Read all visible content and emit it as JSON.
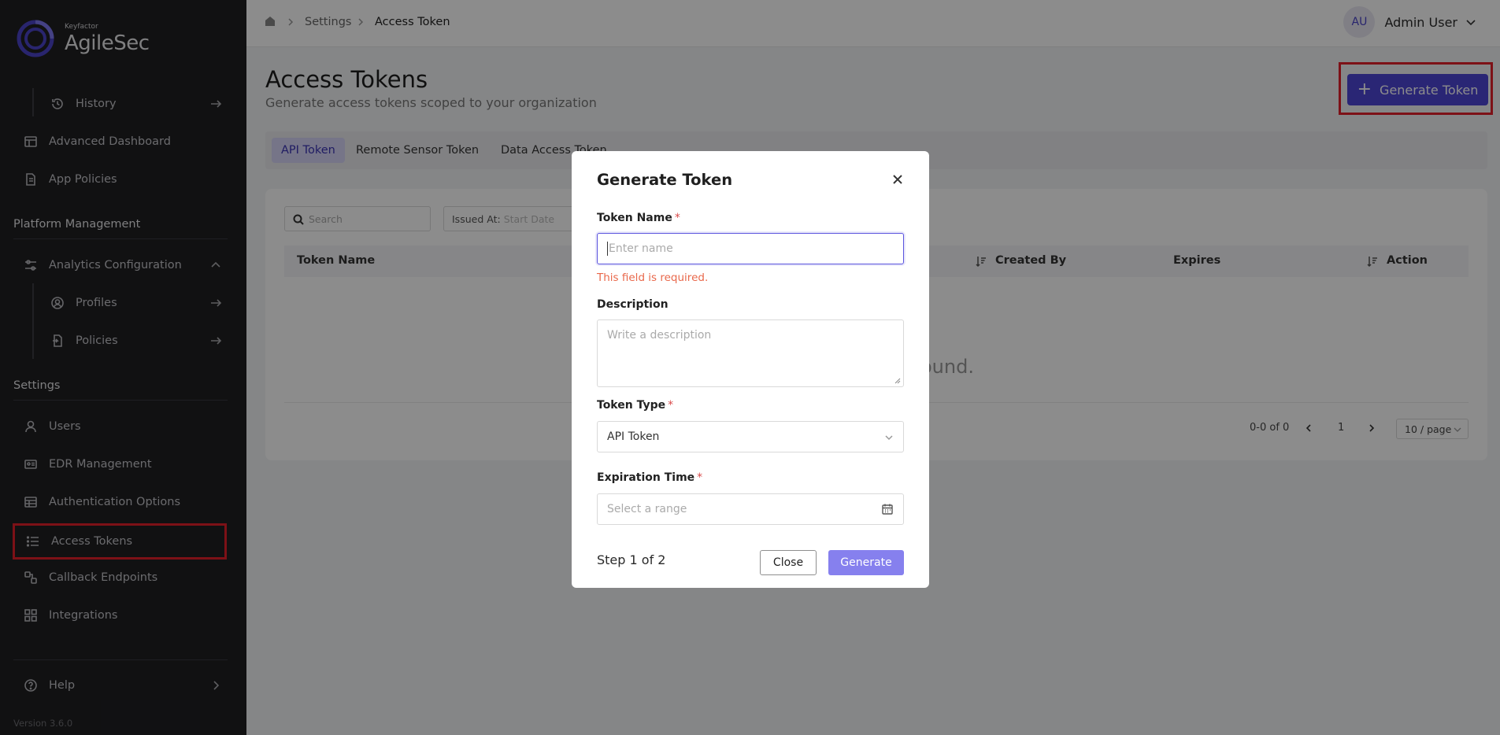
{
  "app": {
    "brand_small": "Keyfactor",
    "brand_name": "AgileSec",
    "version": "Version 3.6.0"
  },
  "sidebar": {
    "items": [
      {
        "label": "History",
        "icon": "history-icon"
      },
      {
        "label": "Advanced Dashboard",
        "icon": "dashboard-icon"
      },
      {
        "label": "App Policies",
        "icon": "document-icon"
      },
      {
        "label": "Analytics Configuration",
        "icon": "sliders-icon"
      },
      {
        "label": "Profiles",
        "icon": "user-circle-icon"
      },
      {
        "label": "Policies",
        "icon": "file-icon"
      },
      {
        "label": "Users",
        "icon": "user-icon"
      },
      {
        "label": "EDR Management",
        "icon": "id-card-icon"
      },
      {
        "label": "Authentication Options",
        "icon": "table-icon"
      },
      {
        "label": "Access Tokens",
        "icon": "list-icon"
      },
      {
        "label": "Callback Endpoints",
        "icon": "link-icon"
      },
      {
        "label": "Integrations",
        "icon": "grid-icon"
      },
      {
        "label": "Help",
        "icon": "help-icon"
      }
    ],
    "sections": {
      "platform": "Platform Management",
      "settings": "Settings"
    }
  },
  "topbar": {
    "breadcrumb": [
      "Settings",
      "Access Token"
    ],
    "user_initials": "AU",
    "user_name": "Admin User"
  },
  "main": {
    "title": "Access Tokens",
    "subtitle": "Generate access tokens scoped to your organization",
    "generate_button": "Generate Token",
    "tabs": [
      "API Token",
      "Remote Sensor Token",
      "Data Access Token"
    ],
    "search_placeholder": "Search",
    "issued_label": "Issued At:",
    "issued_placeholder": "Start Date",
    "columns": [
      "Token Name",
      "Created By",
      "Expires",
      "Action"
    ],
    "empty_text": "ound.",
    "pagination": {
      "range": "0-0 of 0",
      "page": "1",
      "page_size": "10 / page"
    }
  },
  "modal": {
    "title": "Generate Token",
    "token_name_label": "Token Name",
    "token_name_placeholder": "Enter name",
    "token_name_error": "This field is required.",
    "description_label": "Description",
    "description_placeholder": "Write a description",
    "token_type_label": "Token Type",
    "token_type_value": "API Token",
    "expiration_label": "Expiration Time",
    "expiration_placeholder": "Select a range",
    "step": "Step 1 of 2",
    "close_button": "Close",
    "generate_button": "Generate",
    "required_mark": "*"
  },
  "colors": {
    "accent": "#4d45d6",
    "highlight": "#e3202a",
    "sidebar_bg": "#1f1f22"
  }
}
